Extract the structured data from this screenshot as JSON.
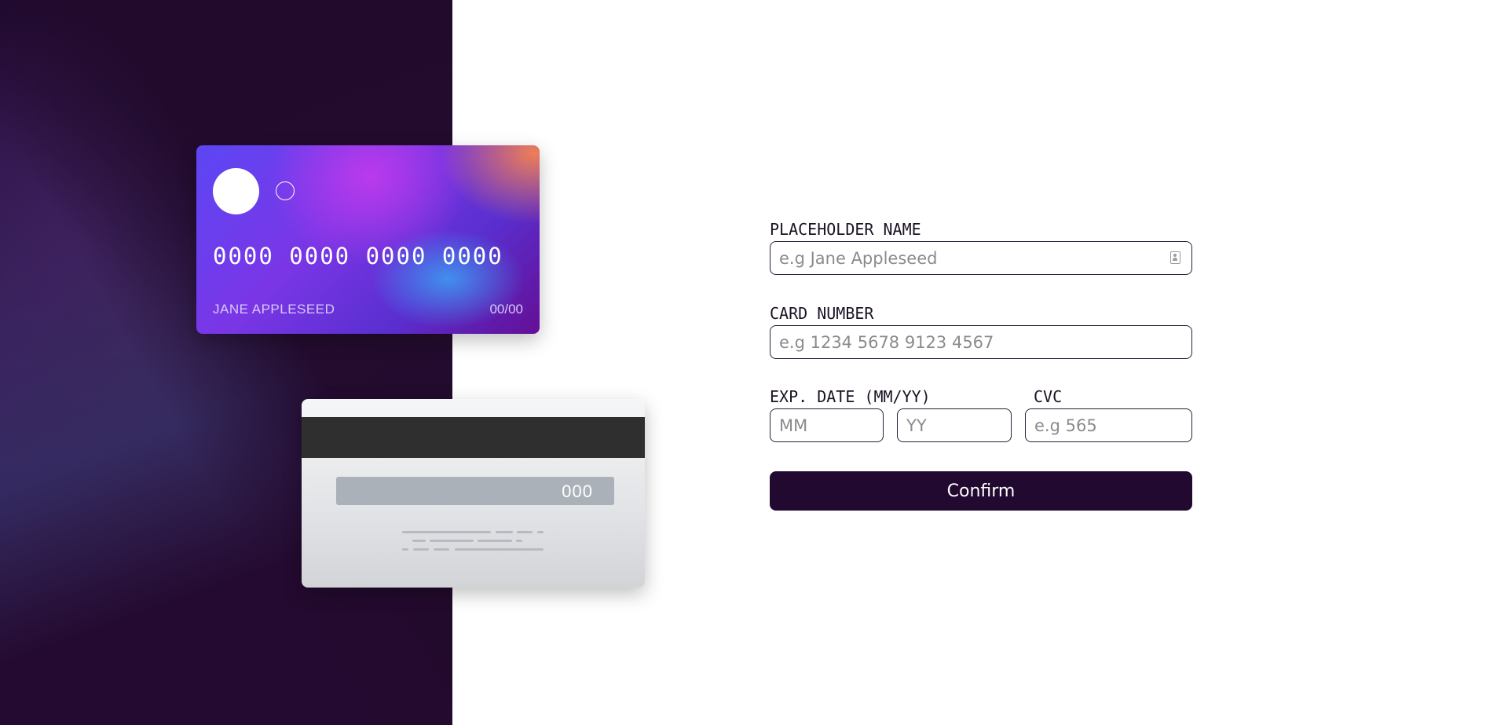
{
  "card_front": {
    "number": "0000 0000 0000 0000",
    "name": "JANE APPLESEED",
    "expiry": "00/00"
  },
  "card_back": {
    "cvc": "000"
  },
  "form": {
    "name_label": "PLACEHOLDER NAME",
    "name_placeholder": "e.g Jane Appleseed",
    "number_label": "CARD NUMBER",
    "number_placeholder": "e.g 1234 5678 9123 4567",
    "exp_label": "EXP. DATE (MM/YY)",
    "mm_placeholder": "MM",
    "yy_placeholder": "YY",
    "cvc_label": "CVC",
    "cvc_placeholder": "e.g 565",
    "confirm_label": "Confirm"
  },
  "colors": {
    "button_bg": "#21092f",
    "input_border": "#2d1e38",
    "background": "#ffffff"
  },
  "icons": {
    "name_field_icon": "contact-card-icon"
  }
}
